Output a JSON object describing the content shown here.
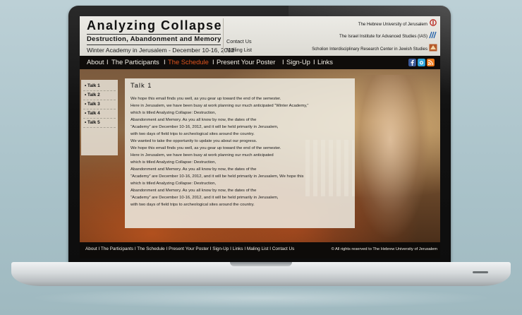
{
  "site": {
    "title": "Analyzing Collapse",
    "subtitle": "Destruction, Abandonment and Memory",
    "date_line": "Winter Academy in Jerusalem - December 10-16, 2012",
    "header_links": [
      "Contact Us",
      "Mailing List"
    ],
    "institutions": [
      "The Hebrew University of Jerusalem",
      "The Israel Institute for Advanced Studies (IAS)",
      "Scholion Interdisciplinary Research Center in Jewish Studies"
    ]
  },
  "nav": {
    "items": [
      "About",
      "The Participants",
      "The Schedule",
      "Present Your Poster",
      "Sign-Up",
      "Links"
    ],
    "separator": "I",
    "active": "The Schedule",
    "active_color": "#e0541e"
  },
  "social": {
    "icons": [
      "facebook-icon",
      "twitter-icon",
      "rss-icon"
    ],
    "colors": {
      "facebook": "#3b5998",
      "twitter": "#2fa4d9",
      "rss": "#f07a1a"
    }
  },
  "sidebar": {
    "items": [
      "• Talk 1",
      "• Talk 2",
      "• Talk 3",
      "• Talk 4",
      "• Talk 5"
    ]
  },
  "content": {
    "title": "Talk 1",
    "lines": [
      "We hope this email finds you well, as you gear up toward the end of the semester.",
      " Here in Jerusalem, we have been busy at work planning our much anticipated  “Winter Academy,”",
      "which is titled Analyzing Collapse: Destruction,",
      "Abandonment and Memory. As you all know by now, the dates of the",
      "“Academy” are December 10-16, 2012, and it will be held primarily in Jerusalem,",
      "with two days of field trips to archeological sites around the country.",
      "We wanted to take the opportunity to update you about our progress.",
      "We hope this email finds you well, as you gear up toward the end of the semester.",
      " Here in Jerusalem, we have been busy at work planning our much anticipated",
      "which is titled Analyzing Collapse: Destruction,",
      "Abandonment and Memory. As you all know by now, the dates of the",
      "“Academy” are December 10-16, 2012, and it will be held primarily in Jerusalem, We hope this",
      "which is titled Analyzing Collapse: Destruction,",
      "Abandonment and Memory. As you all know by now, the dates of the",
      "“Academy” are December 10-16, 2012, and it will be held primarily in Jerusalem,",
      "with two days of field trips to archeological sites around the country."
    ]
  },
  "footer": {
    "links": "About I The Participants I The Schedule I Present Your Poster I Sign-Up I Links I Maling List I Contact Us",
    "copyright": "© All rights reserved to The Hebrew University of Jerusalem"
  },
  "colors": {
    "accent": "#e0541e",
    "header_bg": "#e6e4dd",
    "nav_bg": "#0f0c0a"
  }
}
